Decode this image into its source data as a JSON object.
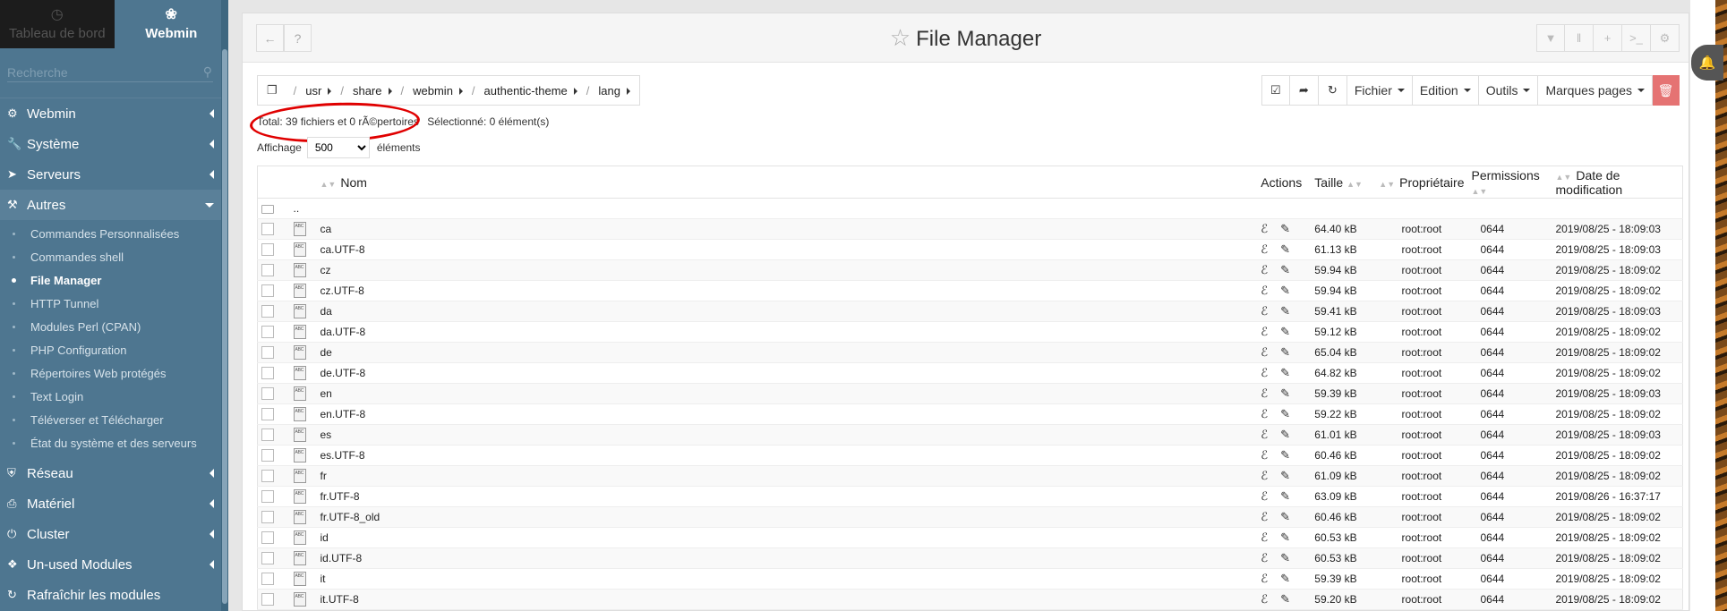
{
  "sidebar": {
    "tabs": [
      {
        "label": "Tableau de bord",
        "icon": "dashboard-icon"
      },
      {
        "label": "Webmin",
        "icon": "webmin-logo-icon"
      }
    ],
    "search_placeholder": "Recherche",
    "nav": [
      {
        "label": "Webmin",
        "icon": "webmin-icon"
      },
      {
        "label": "Système",
        "icon": "wrench-icon"
      },
      {
        "label": "Serveurs",
        "icon": "rocket-icon"
      },
      {
        "label": "Autres",
        "icon": "tools-icon",
        "open": true
      }
    ],
    "sub_items": [
      "Commandes Personnalisées",
      "Commandes shell",
      "File Manager",
      "HTTP Tunnel",
      "Modules Perl (CPAN)",
      "PHP Configuration",
      "Répertoires Web protégés",
      "Text Login",
      "Téléverser et Télécharger",
      "État du système et des serveurs"
    ],
    "active_sub": "File Manager",
    "nav_bottom": [
      {
        "label": "Réseau",
        "icon": "shield-icon"
      },
      {
        "label": "Matériel",
        "icon": "printer-icon"
      },
      {
        "label": "Cluster",
        "icon": "power-icon"
      },
      {
        "label": "Un-used Modules",
        "icon": "puzzle-icon"
      },
      {
        "label": "Rafraîchir les modules",
        "icon": "refresh-icon"
      }
    ]
  },
  "header": {
    "title": "File Manager"
  },
  "breadcrumb": [
    "usr",
    "share",
    "webmin",
    "authentic-theme",
    "lang"
  ],
  "toolbar": {
    "fichier": "Fichier",
    "edition": "Edition",
    "outils": "Outils",
    "marques": "Marques pages"
  },
  "info": {
    "total": "Total: 39 fichiers et 0 rÃ©pertoires",
    "selected": "Sélectionné: 0 élément(s)"
  },
  "perpage": {
    "label": "Affichage",
    "value": "500",
    "suffix": "éléments"
  },
  "table": {
    "columns": {
      "name": "Nom",
      "actions": "Actions",
      "size": "Taille",
      "owner": "Propriétaire",
      "perms": "Permissions",
      "date": "Date de modification"
    },
    "parent": "..",
    "rows": [
      {
        "name": "ca",
        "size": "64.40 kB",
        "owner": "root:root",
        "perms": "0644",
        "date": "2019/08/25 - 18:09:03"
      },
      {
        "name": "ca.UTF-8",
        "size": "61.13 kB",
        "owner": "root:root",
        "perms": "0644",
        "date": "2019/08/25 - 18:09:03"
      },
      {
        "name": "cz",
        "size": "59.94 kB",
        "owner": "root:root",
        "perms": "0644",
        "date": "2019/08/25 - 18:09:02"
      },
      {
        "name": "cz.UTF-8",
        "size": "59.94 kB",
        "owner": "root:root",
        "perms": "0644",
        "date": "2019/08/25 - 18:09:02"
      },
      {
        "name": "da",
        "size": "59.41 kB",
        "owner": "root:root",
        "perms": "0644",
        "date": "2019/08/25 - 18:09:03"
      },
      {
        "name": "da.UTF-8",
        "size": "59.12 kB",
        "owner": "root:root",
        "perms": "0644",
        "date": "2019/08/25 - 18:09:02"
      },
      {
        "name": "de",
        "size": "65.04 kB",
        "owner": "root:root",
        "perms": "0644",
        "date": "2019/08/25 - 18:09:02"
      },
      {
        "name": "de.UTF-8",
        "size": "64.82 kB",
        "owner": "root:root",
        "perms": "0644",
        "date": "2019/08/25 - 18:09:02"
      },
      {
        "name": "en",
        "size": "59.39 kB",
        "owner": "root:root",
        "perms": "0644",
        "date": "2019/08/25 - 18:09:03"
      },
      {
        "name": "en.UTF-8",
        "size": "59.22 kB",
        "owner": "root:root",
        "perms": "0644",
        "date": "2019/08/25 - 18:09:02"
      },
      {
        "name": "es",
        "size": "61.01 kB",
        "owner": "root:root",
        "perms": "0644",
        "date": "2019/08/25 - 18:09:03"
      },
      {
        "name": "es.UTF-8",
        "size": "60.46 kB",
        "owner": "root:root",
        "perms": "0644",
        "date": "2019/08/25 - 18:09:02"
      },
      {
        "name": "fr",
        "size": "61.09 kB",
        "owner": "root:root",
        "perms": "0644",
        "date": "2019/08/25 - 18:09:02"
      },
      {
        "name": "fr.UTF-8",
        "size": "63.09 kB",
        "owner": "root:root",
        "perms": "0644",
        "date": "2019/08/26 - 16:37:17"
      },
      {
        "name": "fr.UTF-8_old",
        "size": "60.46 kB",
        "owner": "root:root",
        "perms": "0644",
        "date": "2019/08/25 - 18:09:02"
      },
      {
        "name": "id",
        "size": "60.53 kB",
        "owner": "root:root",
        "perms": "0644",
        "date": "2019/08/25 - 18:09:02"
      },
      {
        "name": "id.UTF-8",
        "size": "60.53 kB",
        "owner": "root:root",
        "perms": "0644",
        "date": "2019/08/25 - 18:09:02"
      },
      {
        "name": "it",
        "size": "59.39 kB",
        "owner": "root:root",
        "perms": "0644",
        "date": "2019/08/25 - 18:09:02"
      },
      {
        "name": "it.UTF-8",
        "size": "59.20 kB",
        "owner": "root:root",
        "perms": "0644",
        "date": "2019/08/25 - 18:09:02"
      }
    ]
  },
  "colors": {
    "sidebar": "#4e7690",
    "danger": "#e57373",
    "highlight_circle": "#e00000"
  }
}
